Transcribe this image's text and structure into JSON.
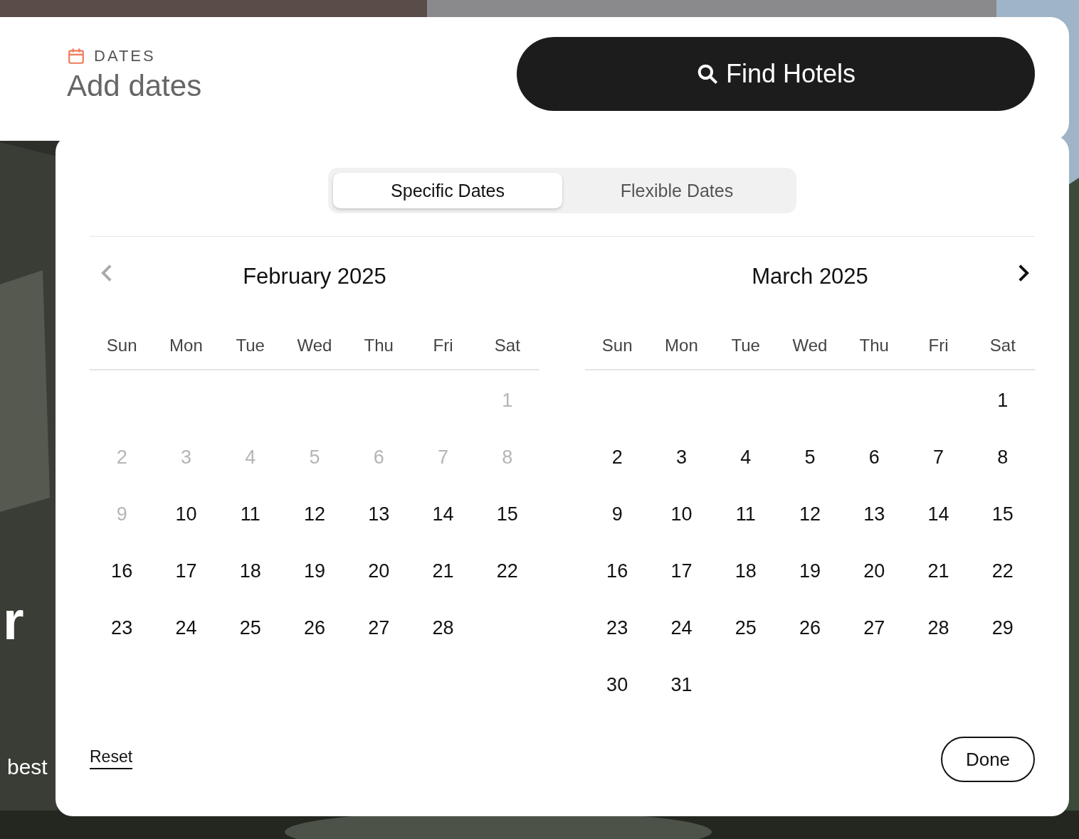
{
  "background_text": {
    "title": "r",
    "subtitle": "best"
  },
  "search_bar": {
    "label": "DATES",
    "value": "Add dates",
    "button": "Find Hotels"
  },
  "tabs": [
    {
      "label": "Specific Dates",
      "selected": true
    },
    {
      "label": "Flexible Dates",
      "selected": false
    }
  ],
  "nav": {
    "prev_disabled": true,
    "next_disabled": false
  },
  "months": [
    {
      "title": "February 2025",
      "weekdays": [
        "Sun",
        "Mon",
        "Tue",
        "Wed",
        "Thu",
        "Fri",
        "Sat"
      ],
      "weeks": [
        [
          {
            "kind": "blank"
          },
          {
            "kind": "blank"
          },
          {
            "kind": "blank"
          },
          {
            "kind": "blank"
          },
          {
            "kind": "blank"
          },
          {
            "kind": "blank"
          },
          {
            "kind": "day",
            "label": "1",
            "disabled": true
          }
        ],
        [
          {
            "kind": "day",
            "label": "2",
            "disabled": true
          },
          {
            "kind": "day",
            "label": "3",
            "disabled": true
          },
          {
            "kind": "day",
            "label": "4",
            "disabled": true
          },
          {
            "kind": "day",
            "label": "5",
            "disabled": true
          },
          {
            "kind": "day",
            "label": "6",
            "disabled": true
          },
          {
            "kind": "day",
            "label": "7",
            "disabled": true
          },
          {
            "kind": "day",
            "label": "8",
            "disabled": true
          }
        ],
        [
          {
            "kind": "day",
            "label": "9",
            "disabled": true
          },
          {
            "kind": "day",
            "label": "10",
            "disabled": false
          },
          {
            "kind": "day",
            "label": "11",
            "disabled": false
          },
          {
            "kind": "day",
            "label": "12",
            "disabled": false
          },
          {
            "kind": "day",
            "label": "13",
            "disabled": false
          },
          {
            "kind": "day",
            "label": "14",
            "disabled": false
          },
          {
            "kind": "day",
            "label": "15",
            "disabled": false
          }
        ],
        [
          {
            "kind": "day",
            "label": "16",
            "disabled": false
          },
          {
            "kind": "day",
            "label": "17",
            "disabled": false
          },
          {
            "kind": "day",
            "label": "18",
            "disabled": false
          },
          {
            "kind": "day",
            "label": "19",
            "disabled": false
          },
          {
            "kind": "day",
            "label": "20",
            "disabled": false
          },
          {
            "kind": "day",
            "label": "21",
            "disabled": false
          },
          {
            "kind": "day",
            "label": "22",
            "disabled": false
          }
        ],
        [
          {
            "kind": "day",
            "label": "23",
            "disabled": false
          },
          {
            "kind": "day",
            "label": "24",
            "disabled": false
          },
          {
            "kind": "day",
            "label": "25",
            "disabled": false
          },
          {
            "kind": "day",
            "label": "26",
            "disabled": false
          },
          {
            "kind": "day",
            "label": "27",
            "disabled": false
          },
          {
            "kind": "day",
            "label": "28",
            "disabled": false
          },
          {
            "kind": "blank"
          }
        ]
      ]
    },
    {
      "title": "March 2025",
      "weekdays": [
        "Sun",
        "Mon",
        "Tue",
        "Wed",
        "Thu",
        "Fri",
        "Sat"
      ],
      "weeks": [
        [
          {
            "kind": "blank"
          },
          {
            "kind": "blank"
          },
          {
            "kind": "blank"
          },
          {
            "kind": "blank"
          },
          {
            "kind": "blank"
          },
          {
            "kind": "blank"
          },
          {
            "kind": "day",
            "label": "1",
            "disabled": false
          }
        ],
        [
          {
            "kind": "day",
            "label": "2",
            "disabled": false
          },
          {
            "kind": "day",
            "label": "3",
            "disabled": false
          },
          {
            "kind": "day",
            "label": "4",
            "disabled": false
          },
          {
            "kind": "day",
            "label": "5",
            "disabled": false
          },
          {
            "kind": "day",
            "label": "6",
            "disabled": false
          },
          {
            "kind": "day",
            "label": "7",
            "disabled": false
          },
          {
            "kind": "day",
            "label": "8",
            "disabled": false
          }
        ],
        [
          {
            "kind": "day",
            "label": "9",
            "disabled": false
          },
          {
            "kind": "day",
            "label": "10",
            "disabled": false
          },
          {
            "kind": "day",
            "label": "11",
            "disabled": false
          },
          {
            "kind": "day",
            "label": "12",
            "disabled": false
          },
          {
            "kind": "day",
            "label": "13",
            "disabled": false
          },
          {
            "kind": "day",
            "label": "14",
            "disabled": false
          },
          {
            "kind": "day",
            "label": "15",
            "disabled": false
          }
        ],
        [
          {
            "kind": "day",
            "label": "16",
            "disabled": false
          },
          {
            "kind": "day",
            "label": "17",
            "disabled": false
          },
          {
            "kind": "day",
            "label": "18",
            "disabled": false
          },
          {
            "kind": "day",
            "label": "19",
            "disabled": false
          },
          {
            "kind": "day",
            "label": "20",
            "disabled": false
          },
          {
            "kind": "day",
            "label": "21",
            "disabled": false
          },
          {
            "kind": "day",
            "label": "22",
            "disabled": false
          }
        ],
        [
          {
            "kind": "day",
            "label": "23",
            "disabled": false
          },
          {
            "kind": "day",
            "label": "24",
            "disabled": false
          },
          {
            "kind": "day",
            "label": "25",
            "disabled": false
          },
          {
            "kind": "day",
            "label": "26",
            "disabled": false
          },
          {
            "kind": "day",
            "label": "27",
            "disabled": false
          },
          {
            "kind": "day",
            "label": "28",
            "disabled": false
          },
          {
            "kind": "day",
            "label": "29",
            "disabled": false
          }
        ],
        [
          {
            "kind": "day",
            "label": "30",
            "disabled": false
          },
          {
            "kind": "day",
            "label": "31",
            "disabled": false
          },
          {
            "kind": "blank"
          },
          {
            "kind": "blank"
          },
          {
            "kind": "blank"
          },
          {
            "kind": "blank"
          },
          {
            "kind": "blank"
          }
        ]
      ]
    }
  ],
  "footer": {
    "reset": "Reset",
    "done": "Done"
  }
}
